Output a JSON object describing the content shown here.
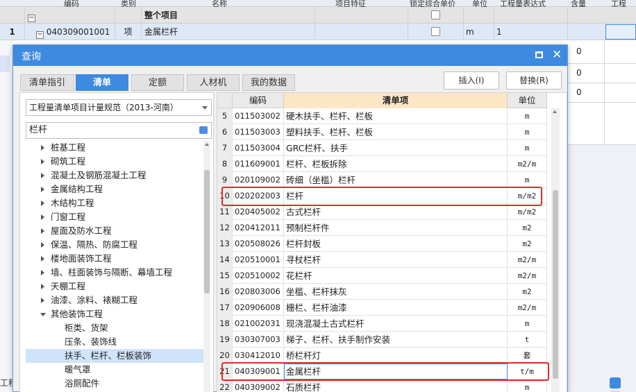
{
  "background": {
    "header_columns": [
      "编码",
      "类别",
      "名称",
      "项目特征",
      "锁定综合单价",
      "单位",
      "工程量表达式",
      "含量",
      "工程"
    ],
    "project_row": {
      "label": "整个项目"
    },
    "item_row": {
      "row_no": "1",
      "code": "040309001001",
      "category": "项",
      "name": "金属栏杆",
      "unit": "m",
      "expression": "1"
    },
    "right_values": [
      "0",
      "0",
      "0"
    ],
    "bottom_left_text": "工程"
  },
  "dialog": {
    "title": "查询",
    "tabs": [
      "清单指引",
      "清单",
      "定额",
      "人材机",
      "我的数据"
    ],
    "active_tab": "清单",
    "insert_button": "插入(I)",
    "replace_button": "替换(R)",
    "spec_select": "工程量清单项目计量规范（2013-河南）",
    "search_value": "栏杆",
    "tree": [
      {
        "label": "桩基工程",
        "level": 1,
        "expandable": true
      },
      {
        "label": "砌筑工程",
        "level": 1,
        "expandable": true
      },
      {
        "label": "混凝土及钢筋混凝土工程",
        "level": 1,
        "expandable": true
      },
      {
        "label": "金属结构工程",
        "level": 1,
        "expandable": true
      },
      {
        "label": "木结构工程",
        "level": 1,
        "expandable": true
      },
      {
        "label": "门窗工程",
        "level": 1,
        "expandable": true
      },
      {
        "label": "屋面及防水工程",
        "level": 1,
        "expandable": true
      },
      {
        "label": "保温、隔热、防腐工程",
        "level": 1,
        "expandable": true
      },
      {
        "label": "楼地面装饰工程",
        "level": 1,
        "expandable": true
      },
      {
        "label": "墙、柱面装饰与隔断、幕墙工程",
        "level": 1,
        "expandable": true
      },
      {
        "label": "天棚工程",
        "level": 1,
        "expandable": true
      },
      {
        "label": "油漆、涂料、裱糊工程",
        "level": 1,
        "expandable": true
      },
      {
        "label": "其他装饰工程",
        "level": 1,
        "expanded": true
      },
      {
        "label": "柜类、货架",
        "level": 2
      },
      {
        "label": "压条、装饰线",
        "level": 2
      },
      {
        "label": "扶手、栏杆、栏板装饰",
        "level": 2,
        "selected": true
      },
      {
        "label": "暖气罩",
        "level": 2
      },
      {
        "label": "浴厕配件",
        "level": 2
      }
    ],
    "table": {
      "headers": [
        "编码",
        "清单项",
        "单位"
      ],
      "rows": [
        {
          "no": "5",
          "code": "011503002",
          "name": "硬木扶手、栏杆、栏板",
          "unit": "m"
        },
        {
          "no": "6",
          "code": "011503003",
          "name": "塑料扶手、栏杆、栏板",
          "unit": "m"
        },
        {
          "no": "7",
          "code": "011503004",
          "name": "GRC栏杆、扶手",
          "unit": "m"
        },
        {
          "no": "8",
          "code": "011609001",
          "name": "栏杆、栏板拆除",
          "unit": "m2/m"
        },
        {
          "no": "9",
          "code": "020109002",
          "name": "砖细（坐槛）栏杆",
          "unit": "m"
        },
        {
          "no": "10",
          "code": "020202003",
          "name": "栏杆",
          "unit": "m/m2",
          "highlight": true
        },
        {
          "no": "11",
          "code": "020405002",
          "name": "古式栏杆",
          "unit": "m/m2"
        },
        {
          "no": "12",
          "code": "020412011",
          "name": "预制栏杆件",
          "unit": "m2"
        },
        {
          "no": "13",
          "code": "020508026",
          "name": "栏杆封板",
          "unit": "m2"
        },
        {
          "no": "14",
          "code": "020510001",
          "name": "寻杖栏杆",
          "unit": "m2/m"
        },
        {
          "no": "15",
          "code": "020510002",
          "name": "花栏杆",
          "unit": "m2/m"
        },
        {
          "no": "16",
          "code": "020803006",
          "name": "坐槛、栏杆抹灰",
          "unit": "m2"
        },
        {
          "no": "17",
          "code": "020906008",
          "name": "栅栏、栏杆油漆",
          "unit": "m2/m"
        },
        {
          "no": "18",
          "code": "021002031",
          "name": "现浇混凝土古式栏杆",
          "unit": "m"
        },
        {
          "no": "19",
          "code": "030307003",
          "name": "梯子、栏杆、扶手制作安装",
          "unit": "t"
        },
        {
          "no": "20",
          "code": "030412010",
          "name": "桥栏杆灯",
          "unit": "套"
        },
        {
          "no": "21",
          "code": "040309001",
          "name": "金属栏杆",
          "unit": "t/m",
          "highlight": true
        },
        {
          "no": "22",
          "code": "040309002",
          "name": "石质栏杆",
          "unit": "m"
        }
      ]
    }
  },
  "colors": {
    "accent": "#3d8ae0",
    "highlight_box": "#e02a2a",
    "header_orange": "#fbe7c4"
  }
}
